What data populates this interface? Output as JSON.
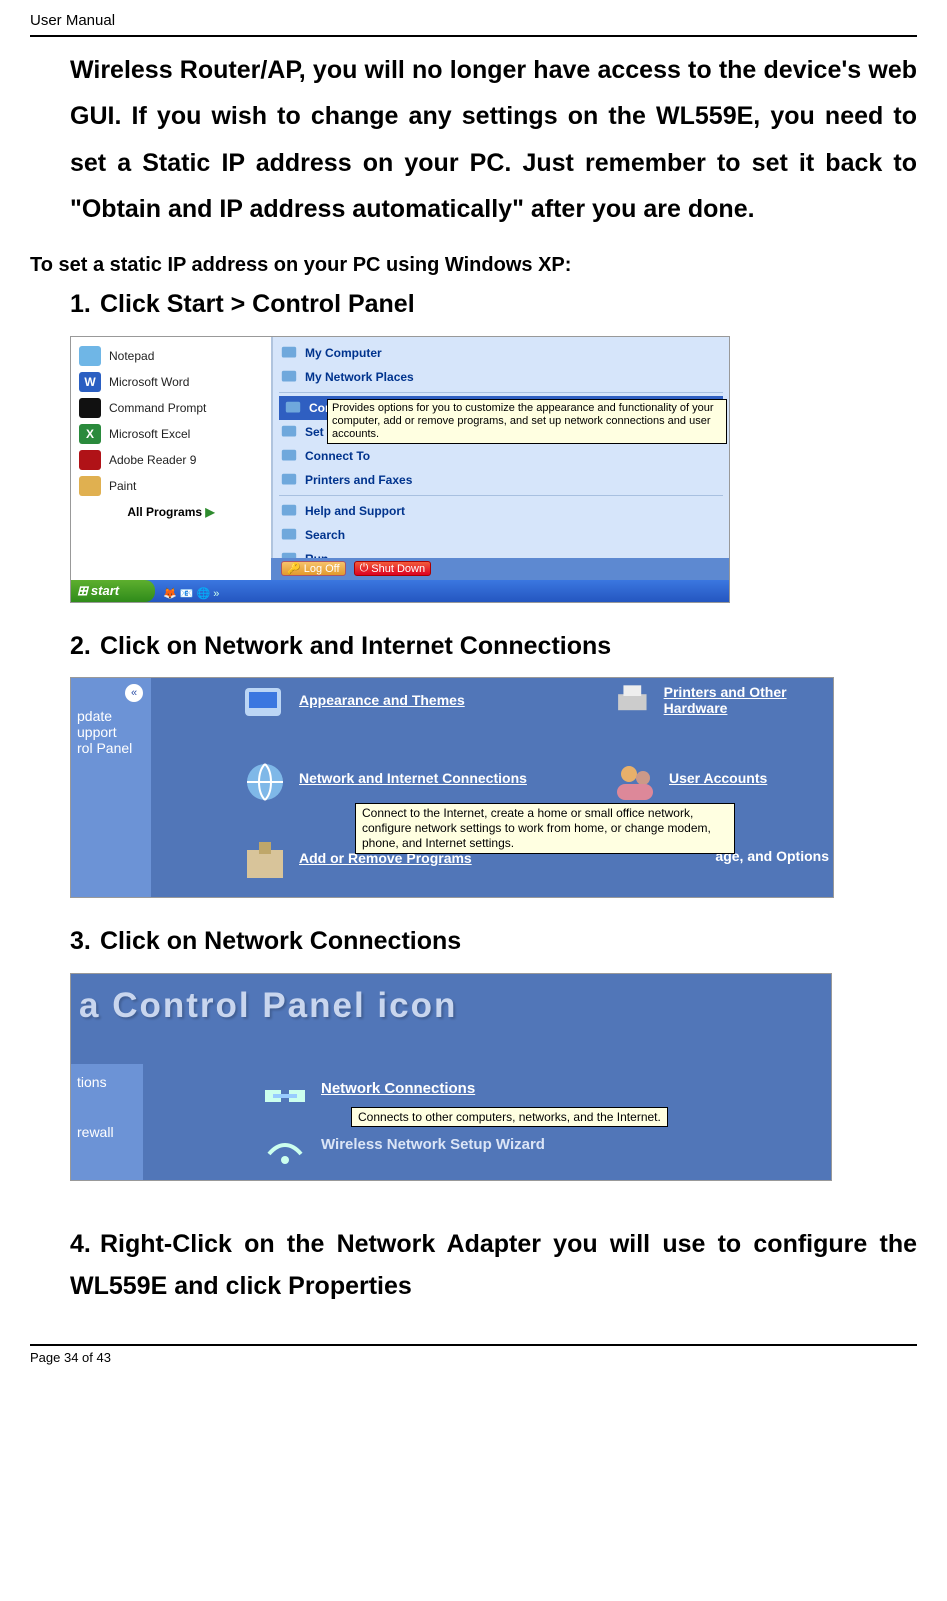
{
  "header": {
    "title": "User Manual"
  },
  "intro": "Wireless Router/AP, you will no longer have access to the device's web GUI. If you wish to change any settings on the WL559E, you need to set a Static IP address on your PC. Just remember to set it back to \"Obtain and IP address automatically\" after you are done.",
  "section_heading": "To set a static IP address on your PC using Windows XP:",
  "steps": [
    {
      "num": "1.",
      "text": "Click Start > Control Panel"
    },
    {
      "num": "2.",
      "text": "Click on Network and Internet Connections"
    },
    {
      "num": "3.",
      "text": "Click on Network Connections"
    },
    {
      "num": "4.",
      "text": "Right-Click on the Network Adapter you will use to configure the WL559E and click Properties"
    }
  ],
  "shot1": {
    "pinned": [
      {
        "label": "Notepad",
        "color": "#6fb6e6"
      },
      {
        "label": "Microsoft Word",
        "color": "#2b5fc2",
        "letter": "W"
      },
      {
        "label": "Command Prompt",
        "color": "#111"
      },
      {
        "label": "Microsoft Excel",
        "color": "#2a8a3c",
        "letter": "X"
      },
      {
        "label": "Adobe Reader 9",
        "color": "#b01217"
      },
      {
        "label": "Paint",
        "color": "#e0b050"
      }
    ],
    "all_programs": "All Programs",
    "right_items": [
      "My Computer",
      "My Network Places",
      "Control Panel",
      "Set Program Access and Defaults",
      "Connect To",
      "Printers and Faxes",
      "Help and Support",
      "Search",
      "Run..."
    ],
    "selected_index": 2,
    "tooltip": "Provides options for you to customize the appearance and functionality of your computer, add or remove programs, and set up network connections and user accounts.",
    "logoff": "Log Off",
    "shutdown": "Shut Down",
    "start": "start"
  },
  "shot2": {
    "side": [
      "pdate",
      "upport",
      "rol Panel"
    ],
    "cats": [
      {
        "label": "Appearance and Themes"
      },
      {
        "label": "Network and Internet Connections"
      },
      {
        "label": "Add or Remove Programs"
      },
      {
        "label": "Printers and Other Hardware"
      },
      {
        "label": "User Accounts"
      },
      {
        "label_suffix": "age, and Options"
      }
    ],
    "tooltip": "Connect to the Internet, create a home or small office network, configure network settings to work from home, or change modem, phone, and Internet settings."
  },
  "shot3": {
    "title": "a Control Panel icon",
    "side": [
      "tions",
      "rewall"
    ],
    "links": [
      "Network Connections",
      "Wireless Network Setup Wizard"
    ],
    "tooltip": "Connects to other computers, networks, and the Internet."
  },
  "footer": {
    "text": "Page 34 of 43"
  }
}
